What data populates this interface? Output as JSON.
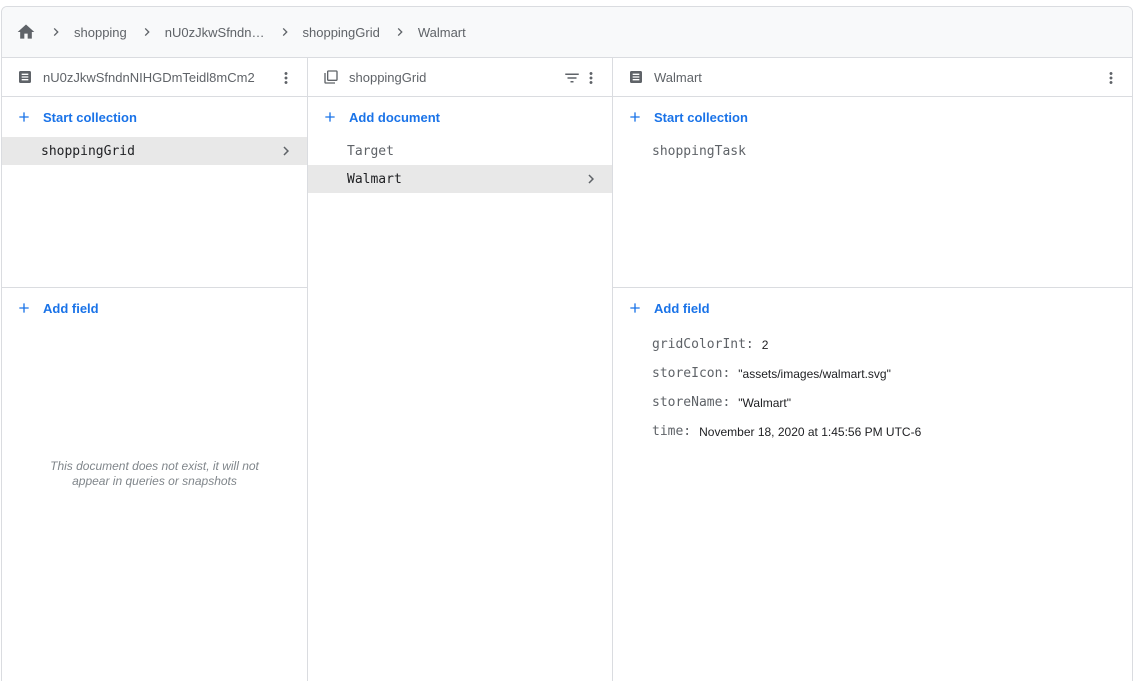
{
  "breadcrumb": {
    "items": [
      "shopping",
      "nU0zJkwSfndn…",
      "shoppingGrid",
      "Walmart"
    ]
  },
  "col1": {
    "title": "nU0zJkwSfndnNIHGDmTeidl8mCm2",
    "start_collection": "Start collection",
    "items": [
      {
        "label": "shoppingGrid"
      }
    ],
    "add_field": "Add field",
    "empty_note_1": "This document does not exist, it will not",
    "empty_note_2": "appear in queries or snapshots"
  },
  "col2": {
    "title": "shoppingGrid",
    "add_document": "Add document",
    "items": [
      {
        "label": "Target"
      },
      {
        "label": "Walmart"
      }
    ]
  },
  "col3": {
    "title": "Walmart",
    "start_collection": "Start collection",
    "items": [
      {
        "label": "shoppingTask"
      }
    ],
    "add_field": "Add field",
    "fields": [
      {
        "key": "gridColorInt:",
        "value": "2"
      },
      {
        "key": "storeIcon:",
        "value": "\"assets/images/walmart.svg\""
      },
      {
        "key": "storeName:",
        "value": "\"Walmart\""
      },
      {
        "key": "time:",
        "value": "November 18, 2020 at 1:45:56 PM UTC-6"
      }
    ]
  },
  "colors": {
    "accent": "#1a73e8",
    "selected_bg": "#e8e8e8",
    "border": "#dadce0"
  }
}
